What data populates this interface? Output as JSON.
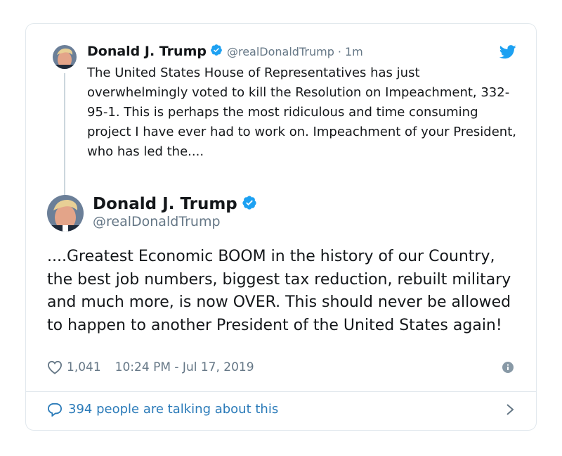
{
  "parent_tweet": {
    "name": "Donald J. Trump",
    "handle": "@realDonaldTrump",
    "separator": "·",
    "time": "1m",
    "text": "The United States House of Representatives has just overwhelmingly voted to kill the Resolution on Impeachment, 332-95-1. This is perhaps the most ridiculous and time consuming project I have ever had to work on. Impeachment of your President, who has led the...."
  },
  "main_tweet": {
    "name": "Donald J. Trump",
    "handle": "@realDonaldTrump",
    "text": "....Greatest Economic BOOM in the history of our Country, the best job numbers, biggest tax reduction, rebuilt military and much more, is now OVER. This should never be allowed to happen to another President of the United States again!",
    "likes": "1,041",
    "timestamp": "10:24 PM - Jul 17, 2019"
  },
  "footer": {
    "talking_label": "394 people are talking about this"
  },
  "icons": {
    "verified": "verified-badge-icon",
    "bird": "twitter-bird-icon",
    "heart": "heart-icon",
    "info": "info-icon",
    "bubble": "speech-bubble-icon",
    "chevron": "chevron-right-icon"
  },
  "colors": {
    "accent": "#1da1f2",
    "link": "#2b7bb9",
    "muted": "#657786",
    "border": "#e1e8ed",
    "text": "#14171a"
  }
}
